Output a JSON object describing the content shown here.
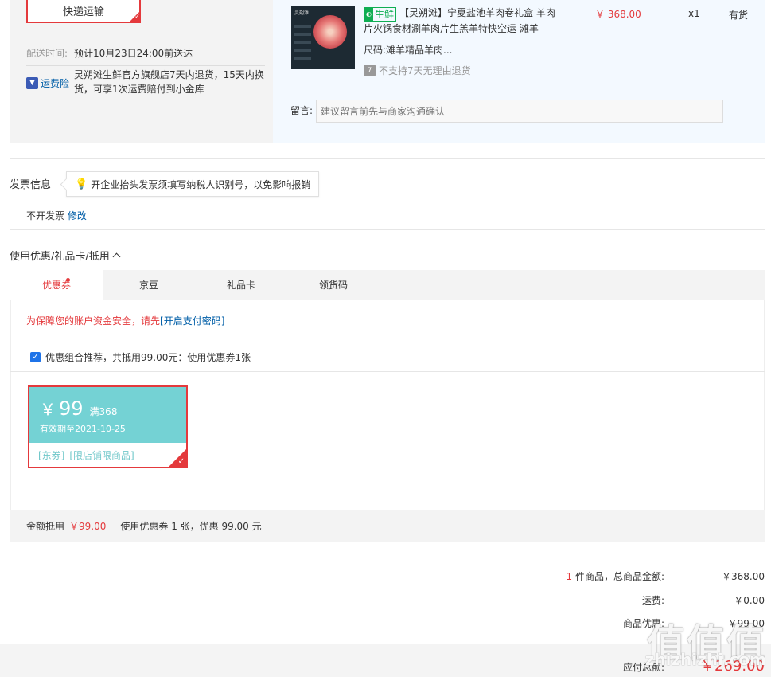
{
  "shipping": {
    "method": "快递运输",
    "time_label": "配送时间:",
    "time_value": "预计10月23日24:00前送达",
    "insurance_label": "运费险",
    "insurance_desc": "灵朔滩生鲜官方旗舰店7天内退货，15天内换货，可享1次运费赔付到小金库"
  },
  "product": {
    "thumb_text": "灵朔滩",
    "fresh_tag": "生鲜",
    "title": "【灵朔滩】宁夏盐池羊肉卷礼盒 羊肉片火锅食材涮羊肉片生羔羊特快空运 滩羊",
    "size_label": "尺码:",
    "size_value": "滩羊精品羊肉...",
    "no_return_icon": "7",
    "no_return": "不支持7天无理由退货",
    "price": "￥ 368.00",
    "qty": "x1",
    "stock": "有货"
  },
  "message": {
    "label": "留言:",
    "placeholder": "建议留言前先与商家沟通确认"
  },
  "invoice": {
    "title": "发票信息",
    "tip": "开企业抬头发票须填写纳税人识别号，以免影响报销",
    "status": "不开发票",
    "edit": "修改"
  },
  "coupons": {
    "title": "使用优惠/礼品卡/抵用",
    "tabs": [
      "优惠券",
      "京豆",
      "礼品卡",
      "领货码"
    ],
    "safe_tip": "为保障您的账户资金安全，请先",
    "safe_link": "[开启支付密码]",
    "combo_text": "优惠组合推荐，共抵用99.00元：使用优惠券1张",
    "card": {
      "currency": "￥",
      "amount": "99",
      "limit": "满368",
      "valid": "有效期至2021-10-25",
      "tag1": "[东券]",
      "tag2": "[限店铺限商品]"
    },
    "deduct_label": "金额抵用",
    "deduct_value": "￥99.00",
    "deduct_desc": "使用优惠券 1 张，优惠 99.00 元"
  },
  "totals": {
    "count": "1",
    "items_label": " 件商品，总商品金额:",
    "items_value": "￥368.00",
    "freight_label": "运费:",
    "freight_value": "￥0.00",
    "discount_label": "商品优惠:",
    "discount_value": "-￥99.00",
    "payable_label": "应付总额:",
    "payable_value": "￥269.00"
  },
  "watermark": {
    "main": "值值值",
    "sub": "zhizhizhi.com"
  },
  "colors": {
    "accent": "#e4393c",
    "link": "#005ea7",
    "coupon": "#74d2d4",
    "fresh": "#0fae53"
  }
}
